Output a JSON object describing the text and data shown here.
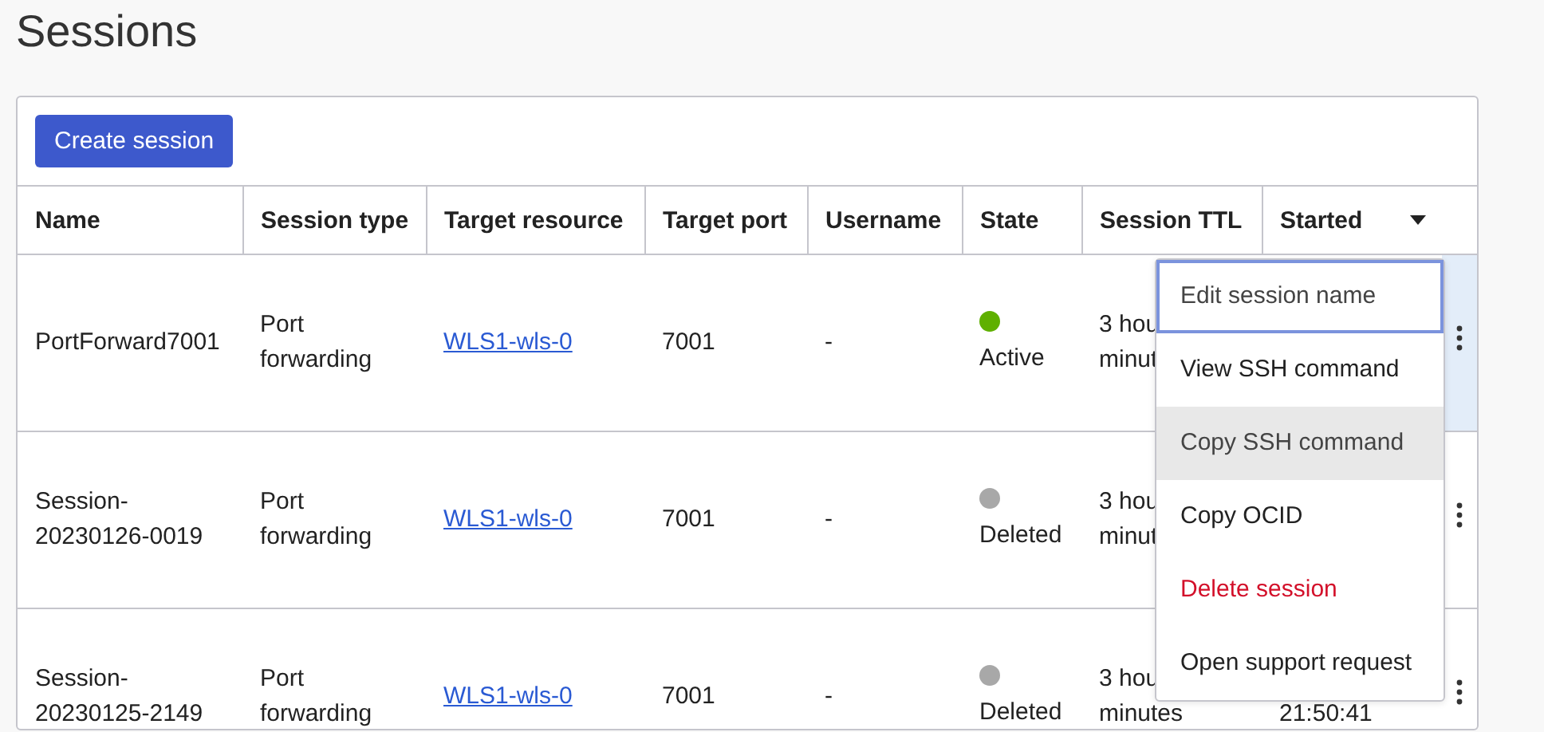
{
  "page": {
    "title": "Sessions"
  },
  "toolbar": {
    "create_button": "Create session"
  },
  "table": {
    "columns": [
      {
        "label": "Name",
        "sorted": false
      },
      {
        "label": "Session type",
        "sorted": false
      },
      {
        "label": "Target resource",
        "sorted": false
      },
      {
        "label": "Target port",
        "sorted": false
      },
      {
        "label": "Username",
        "sorted": false
      },
      {
        "label": "State",
        "sorted": false
      },
      {
        "label": "Session TTL",
        "sorted": false
      },
      {
        "label": "Started",
        "sorted": true
      }
    ],
    "rows": [
      {
        "name": [
          "PortForward7001"
        ],
        "session_type": [
          "Port",
          "forwarding"
        ],
        "target_resource": "WLS1-wls-0",
        "target_port": "7001",
        "username": "-",
        "state": "Active",
        "color": "#5fb000",
        "session_ttl": [
          "3 hou",
          "minut"
        ],
        "started": [],
        "selected": true
      },
      {
        "name": [
          "Session-",
          "20230126-0019"
        ],
        "session_type": [
          "Port",
          "forwarding"
        ],
        "target_resource": "WLS1-wls-0",
        "target_port": "7001",
        "username": "-",
        "state": "Deleted",
        "color": "#a8a8a8",
        "session_ttl": [
          "3 hou",
          "minut"
        ],
        "started": [],
        "selected": false
      },
      {
        "name": [
          "Session-",
          "20230125-2149"
        ],
        "session_type": [
          "Port",
          "forwarding"
        ],
        "target_resource": "WLS1-wls-0",
        "target_port": "7001",
        "username": "-",
        "state": "Deleted",
        "color": "#a8a8a8",
        "session_ttl": [
          "3 hou",
          "minutes"
        ],
        "started": [
          "21:50:41"
        ],
        "selected": false
      }
    ]
  },
  "actions_menu": {
    "items": [
      {
        "label": "Edit session name",
        "kind": "normal",
        "focused": true,
        "hovered": false
      },
      {
        "label": "View SSH command",
        "kind": "normal",
        "focused": false,
        "hovered": false
      },
      {
        "label": "Copy SSH command",
        "kind": "normal",
        "focused": false,
        "hovered": true
      },
      {
        "label": "Copy OCID",
        "kind": "normal",
        "focused": false,
        "hovered": false
      },
      {
        "label": "Delete session",
        "kind": "danger",
        "focused": false,
        "hovered": false
      },
      {
        "label": "Open support request",
        "kind": "normal",
        "focused": false,
        "hovered": false
      }
    ]
  }
}
